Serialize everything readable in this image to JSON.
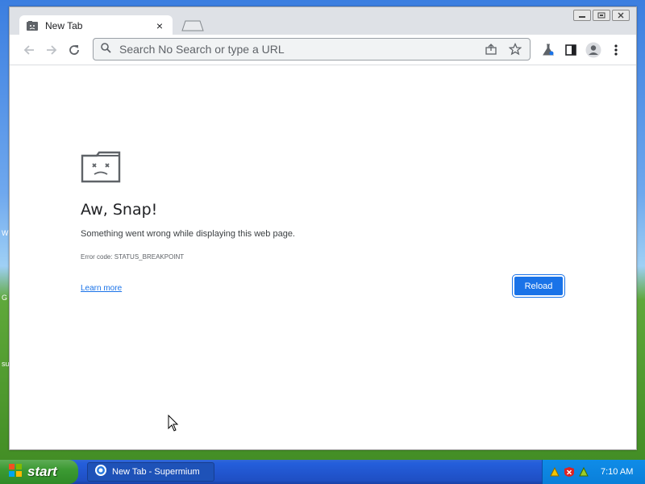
{
  "window": {
    "tab_title": "New Tab",
    "tab_close": "×"
  },
  "toolbar": {
    "omnibox_placeholder": "Search No Search or type a URL"
  },
  "error_page": {
    "heading": "Aw, Snap!",
    "message": "Something went wrong while displaying this web page.",
    "error_code": "Error code: STATUS_BREAKPOINT",
    "learn_more": "Learn more",
    "reload": "Reload"
  },
  "taskbar": {
    "start_label": "start",
    "task_label": "New Tab - Supermium",
    "clock": "7:10 AM"
  },
  "desktop": {
    "labels": [
      "W",
      "G",
      "su"
    ]
  },
  "colors": {
    "accent": "#1a73e8",
    "titlebar": "#dee1e6",
    "taskbar": "#245edb",
    "start": "#3c9a33"
  },
  "icons": [
    "tab-favicon-icon",
    "new-tab-icon",
    "minimize-icon",
    "restore-icon",
    "close-icon",
    "back-icon",
    "forward-icon",
    "reload-icon",
    "search-icon",
    "share-icon",
    "star-icon",
    "labs-icon",
    "side-panel-icon",
    "profile-icon",
    "menu-icon",
    "sad-folder-icon",
    "windows-logo-icon",
    "browser-icon",
    "tray-icon",
    "mouse-cursor-icon"
  ]
}
